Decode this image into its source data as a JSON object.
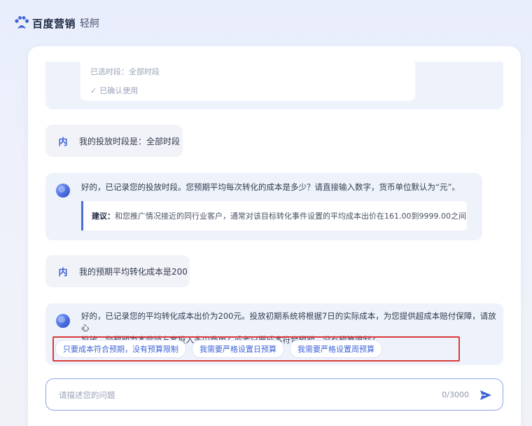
{
  "header": {
    "brand": "百度营销",
    "product": "轻舸"
  },
  "conversation": {
    "confirm_card": {
      "selected_period": "已选时段：全部时段",
      "confirmed": "已确认使用"
    },
    "user_msg_1": {
      "avatar": "内",
      "text": "我的投放时段是：全部时段"
    },
    "bot_msg_1": {
      "text": "好的，已记录您的投放时段。您预期平均每次转化的成本是多少？请直接输入数字，货币单位默认为“元”。",
      "suggestion_label": "建议：",
      "suggestion_text": "和您推广情况接近的同行业客户，通常对该目标转化事件设置的平均成本出价在161.00到9999.00之间"
    },
    "user_msg_2": {
      "avatar": "内",
      "text": "我的预期平均转化成本是200"
    },
    "bot_msg_2": {
      "line1": "好的，已记录您的平均转化成本出价为200元。投放初期系统将根据7日的实际成本，为您提供超成本赔付保障，请放心",
      "line2": "投放。您预期为本营销方案投入多少费用？或者只要成本符合预期，没有预算限制?",
      "options": [
        "只要成本符合预期，没有预算限制",
        "我需要严格设置日预算",
        "我需要严格设置周预算"
      ]
    }
  },
  "input": {
    "placeholder": "请描述您的问题",
    "counter": "0/3000"
  },
  "colors": {
    "accent": "#3e63d6",
    "highlight": "#d93a3a"
  }
}
